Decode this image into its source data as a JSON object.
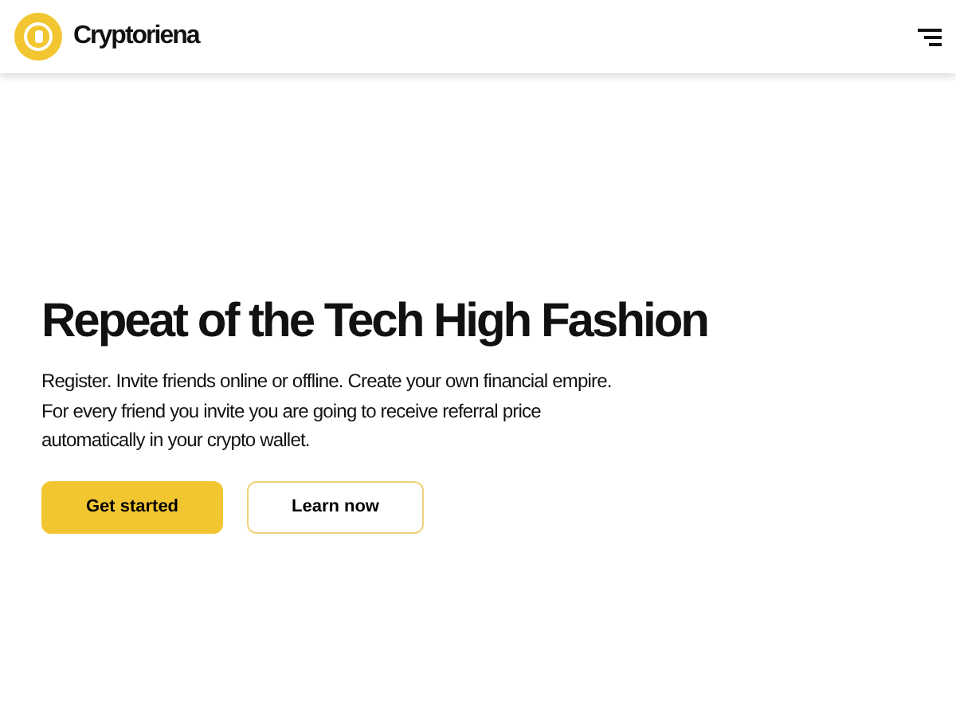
{
  "header": {
    "brand": "Cryptoriena"
  },
  "hero": {
    "heading": "Repeat of the Tech High Fashion",
    "text": "Register. Invite friends online or offline. Create your own financial empire. For every friend you invite you are going to receive referral price automatically in your crypto wallet.",
    "buttons": [
      {
        "label": "Get started",
        "kind": "primary"
      },
      {
        "label": "Learn now",
        "kind": "outline"
      }
    ]
  }
}
